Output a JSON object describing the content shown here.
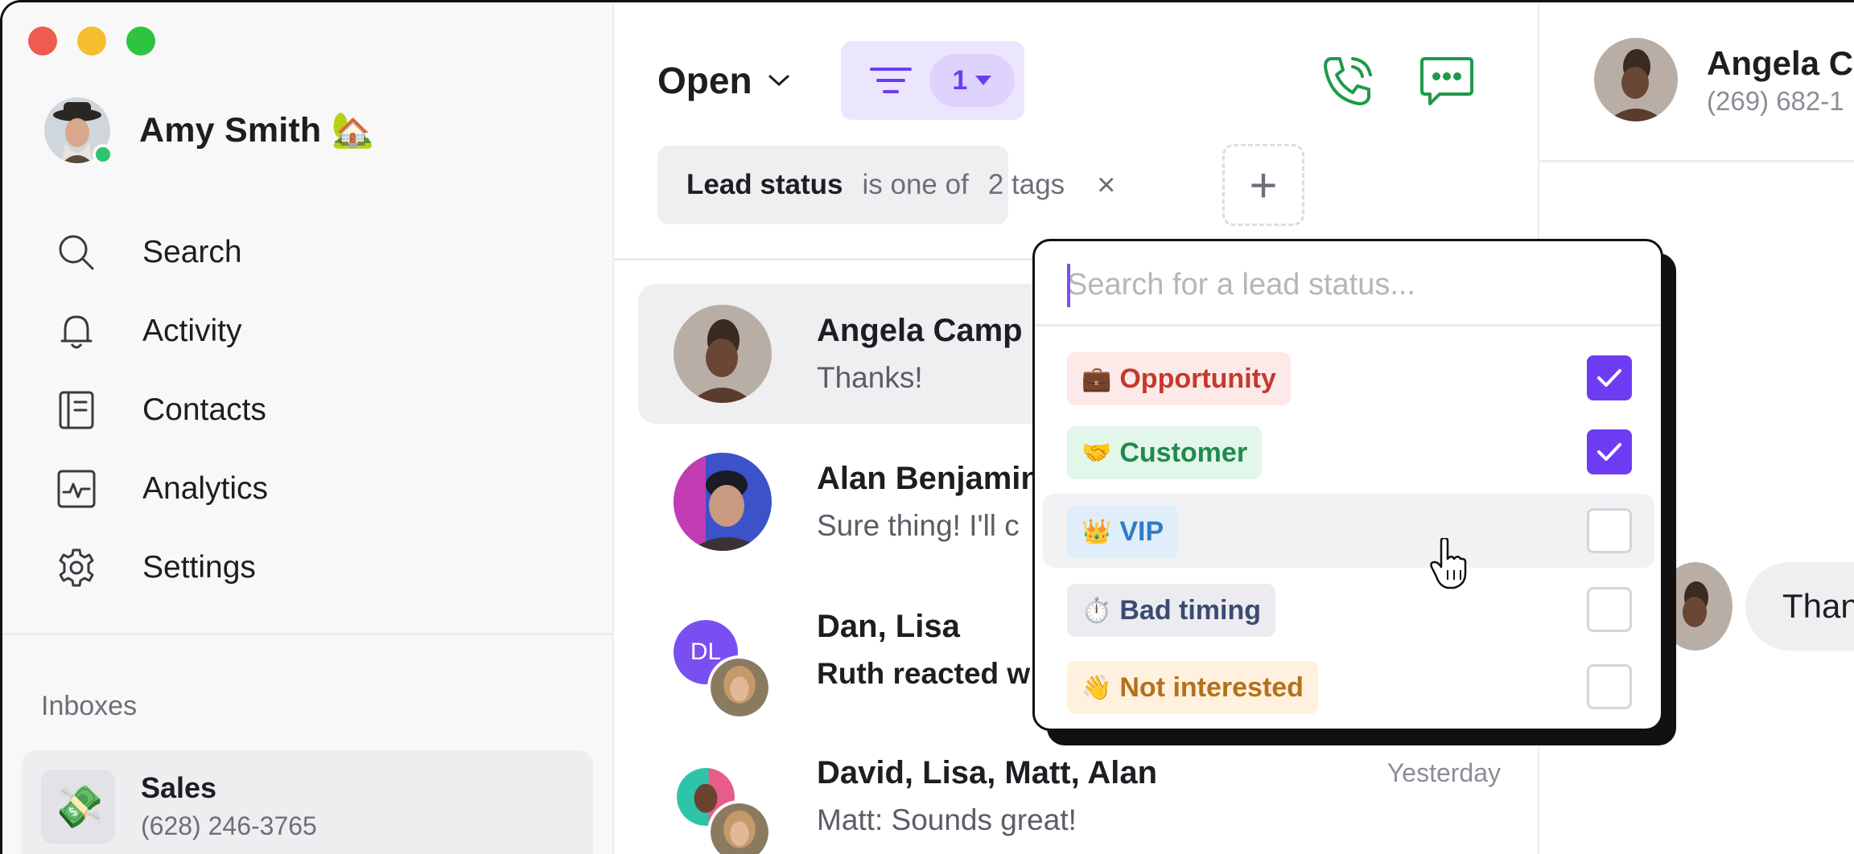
{
  "user": {
    "name": "Amy Smith",
    "emoji": "🏡"
  },
  "nav": [
    {
      "label": "Search",
      "icon": "search-icon"
    },
    {
      "label": "Activity",
      "icon": "bell-icon"
    },
    {
      "label": "Contacts",
      "icon": "contacts-icon"
    },
    {
      "label": "Analytics",
      "icon": "analytics-icon"
    },
    {
      "label": "Settings",
      "icon": "gear-icon"
    }
  ],
  "inboxes": {
    "heading": "Inboxes",
    "items": [
      {
        "name": "Sales",
        "phone": "(628) 246-3765",
        "emoji": "💸"
      }
    ]
  },
  "list_header": {
    "status_label": "Open",
    "filter_count": "1"
  },
  "filter_chip": {
    "field": "Lead status",
    "operator": "is one of",
    "value": "2 tags",
    "remove": "×",
    "add": "+"
  },
  "conversations": [
    {
      "name": "Angela Camp",
      "message": "Thanks!",
      "time": "",
      "unread": false
    },
    {
      "name": "Alan Benjamin",
      "message": "Sure thing! I'll c",
      "time": "",
      "unread": false
    },
    {
      "name": "Dan, Lisa",
      "message": "Ruth reacted w",
      "time": "",
      "initials": "DL",
      "unread": true
    },
    {
      "name": "David, Lisa, Matt, Alan",
      "message": "Matt: Sounds great!",
      "time": "Yesterday",
      "unread": false
    }
  ],
  "dropdown": {
    "placeholder": "Search for a lead status...",
    "options": [
      {
        "emoji": "💼",
        "label": "Opportunity",
        "checked": true,
        "color": "#c23a2c"
      },
      {
        "emoji": "🤝",
        "label": "Customer",
        "checked": true,
        "color": "#1f8a4c"
      },
      {
        "emoji": "👑",
        "label": "VIP",
        "checked": false,
        "color": "#2f7bc5"
      },
      {
        "emoji": "⏱️",
        "label": "Bad timing",
        "checked": false,
        "color": "#3c4a72"
      },
      {
        "emoji": "👋",
        "label": "Not interested",
        "checked": false,
        "color": "#b5701a"
      }
    ]
  },
  "contact": {
    "name": "Angela C",
    "phone": "(269) 682-1",
    "bubble": "Than"
  },
  "colors": {
    "accent": "#6d3cf2",
    "call_green": "#1f9a4a",
    "online": "#2ec46b"
  }
}
